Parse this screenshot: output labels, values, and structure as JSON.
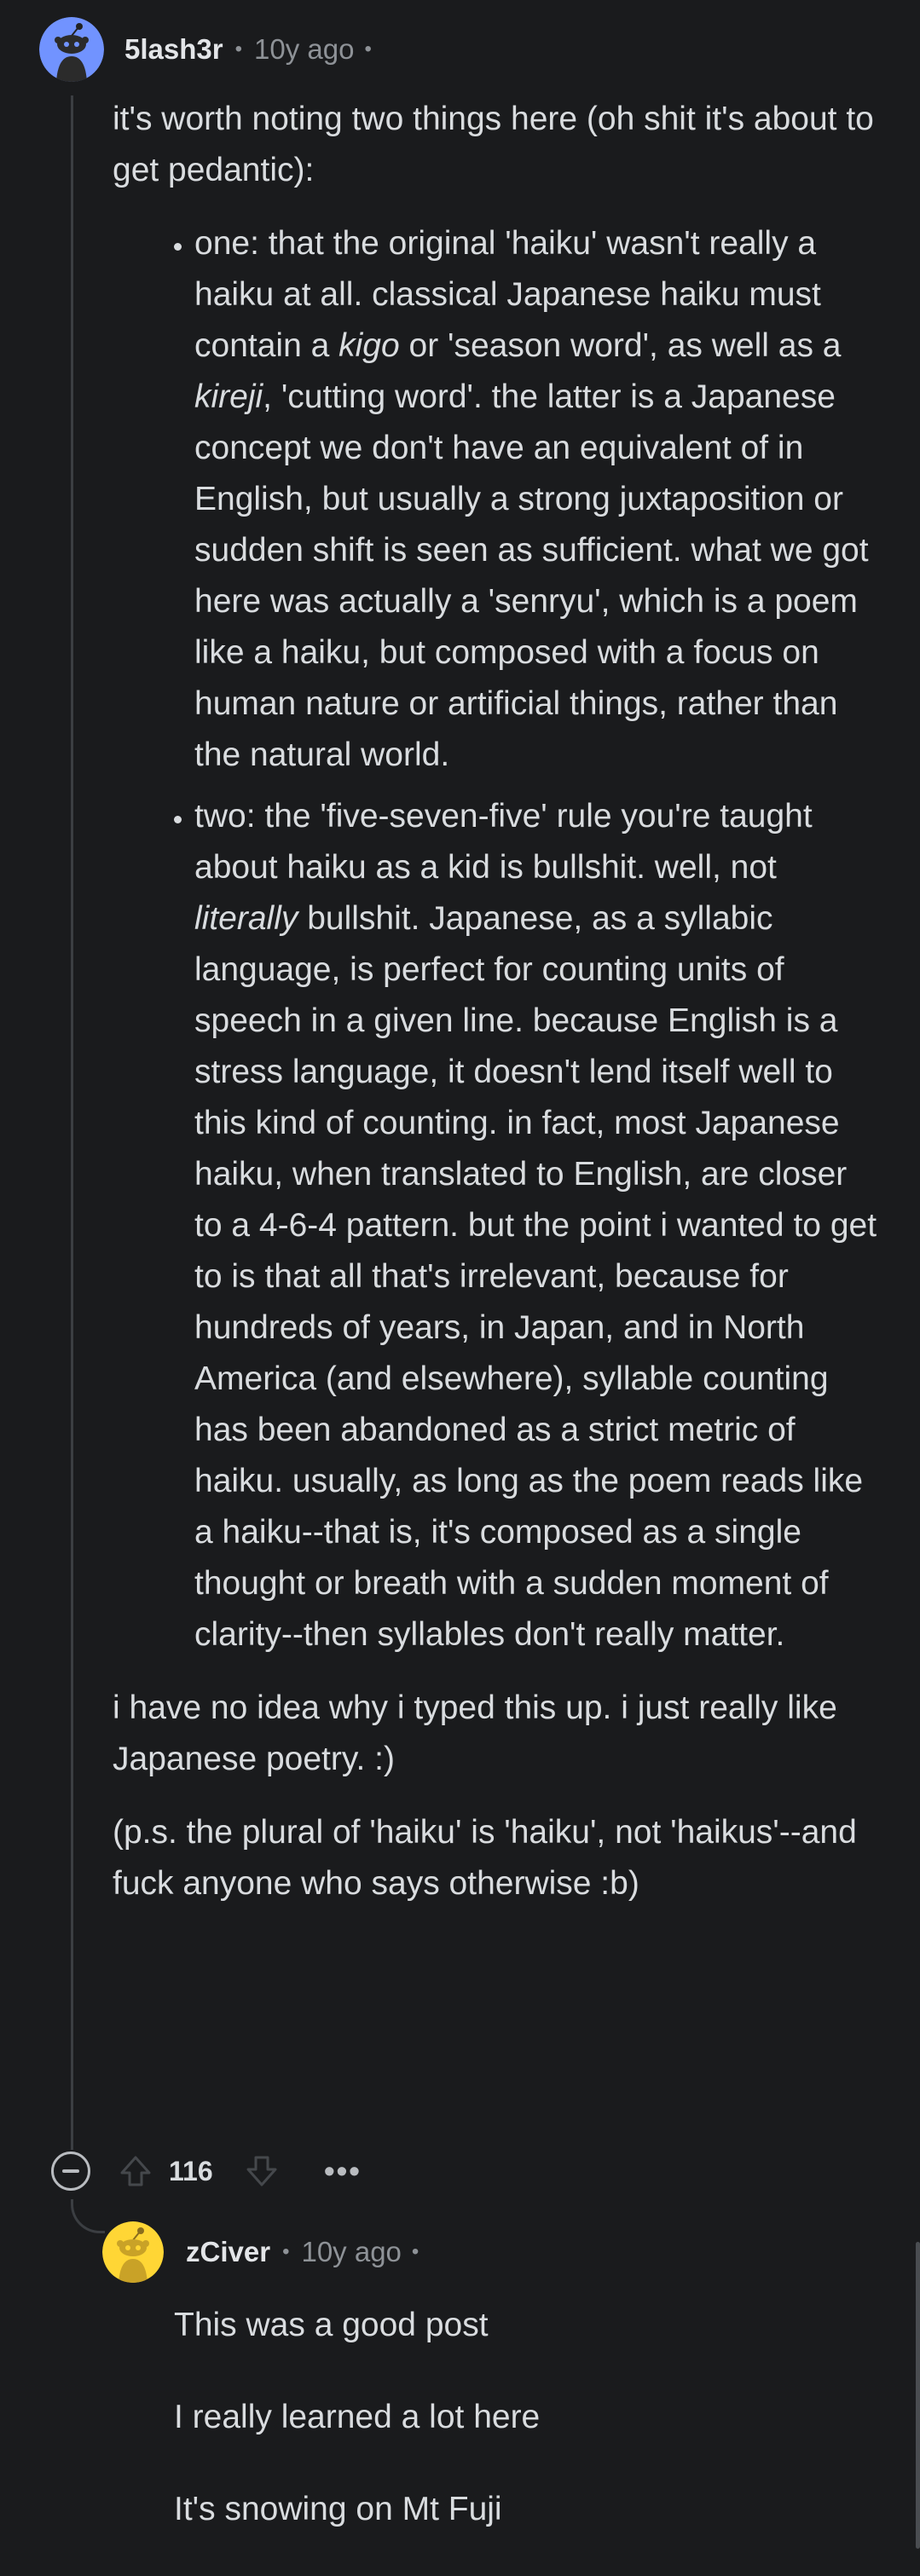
{
  "comment": {
    "username": "5lash3r",
    "separator": "•",
    "time": "10y ago",
    "intro_before": "it's worth noting two things here (oh shit it's about to get pedantic):",
    "bullets": [
      {
        "parts": [
          {
            "text": "one: that the original 'haiku' wasn't really a haiku at all. classical Japanese haiku must contain a ",
            "italic": false
          },
          {
            "text": "kigo",
            "italic": true
          },
          {
            "text": " or 'season word', as well as a ",
            "italic": false
          },
          {
            "text": "kireji",
            "italic": true
          },
          {
            "text": ", 'cutting word'. the latter is a Japanese concept we don't have an equivalent of in English, but usually a strong juxtaposition or sudden shift is seen as sufficient. what we got here was actually a 'senryu', which is a poem like a haiku, but composed with a focus on human nature or artificial things, rather than the natural world.",
            "italic": false
          }
        ]
      },
      {
        "parts": [
          {
            "text": "two: the 'five-seven-five' rule you're taught about haiku as a kid is bullshit. well, not ",
            "italic": false
          },
          {
            "text": "literally",
            "italic": true
          },
          {
            "text": " bullshit. Japanese, as a syllabic language, is perfect for counting units of speech in a given line. because English is a stress language, it doesn't lend itself well to this kind of counting. in fact, most Japanese haiku, when translated to English, are closer to a 4-6-4 pattern. but the point i wanted to get to is that all that's irrelevant, because for hundreds of years, in Japan, and in North America (and elsewhere), syllable counting has been abandoned as a strict metric of haiku. usually, as long as the poem reads like a haiku--that is, it's composed as a single thought or breath with a sudden moment of clarity--then syllables don't really matter.",
            "italic": false
          }
        ]
      }
    ],
    "after_1": "i have no idea why i typed this up. i just really like Japanese poetry. :)",
    "after_2": "(p.s. the plural of 'haiku' is 'haiku', not 'haikus'--and fuck anyone who says otherwise :b)",
    "score": "116",
    "more": "•••",
    "icons": [
      "collapse-icon",
      "upvote-icon",
      "downvote-icon",
      "more-icon"
    ]
  },
  "reply": {
    "username": "zCiver",
    "separator": "•",
    "time": "10y ago",
    "lines": [
      "This was a good post",
      "I really learned a lot here",
      "It's snowing on Mt Fuji"
    ]
  },
  "colors": {
    "background": "#1a1b1d",
    "text": "#d9dcdf",
    "meta": "#8e9297",
    "thread_line": "#3b3e42",
    "avatar_main_bg": "#7193ff",
    "avatar_reply_bg": "#ffd635"
  }
}
